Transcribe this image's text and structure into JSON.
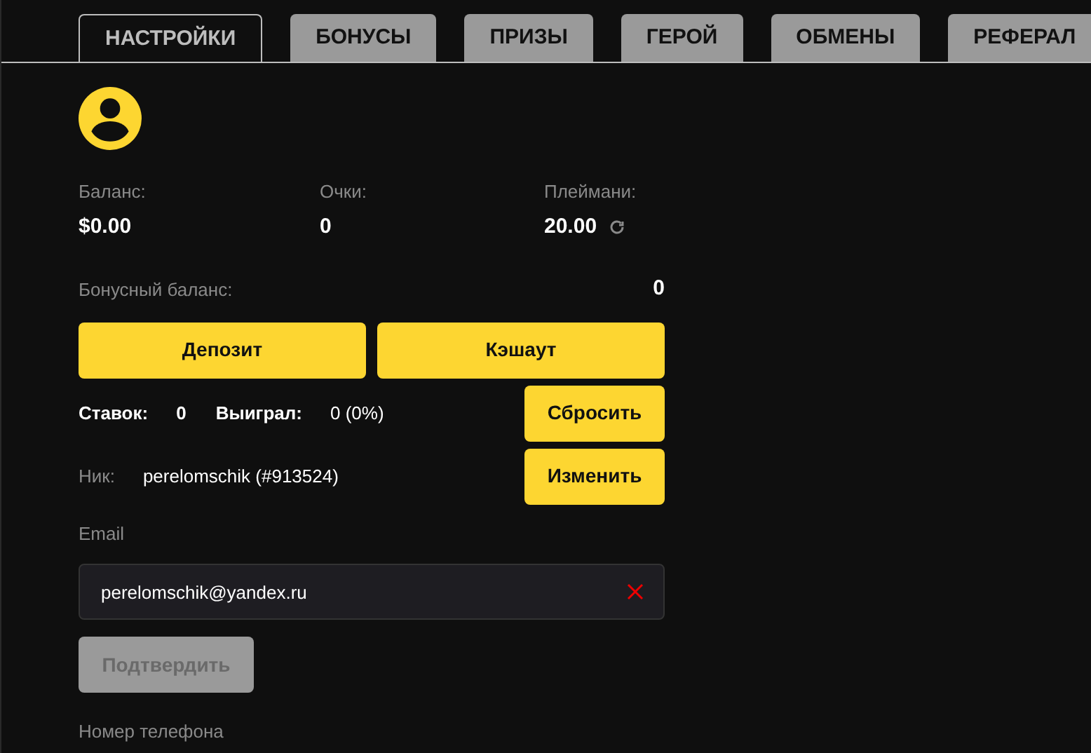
{
  "tabs": [
    {
      "label": "НАСТРОЙКИ",
      "selected": true
    },
    {
      "label": "БОНУСЫ",
      "selected": false
    },
    {
      "label": "ПРИЗЫ",
      "selected": false
    },
    {
      "label": "ГЕРОЙ",
      "selected": false
    },
    {
      "label": "ОБМЕНЫ",
      "selected": false
    },
    {
      "label": "РЕФЕРАЛ",
      "selected": false
    }
  ],
  "stats": [
    {
      "label": "Баланс:",
      "value": "$0.00",
      "refresh": false
    },
    {
      "label": "Очки:",
      "value": "0",
      "refresh": false
    },
    {
      "label": "Плеймани:",
      "value": "20.00",
      "refresh": true
    }
  ],
  "bonus_balance": {
    "label": "Бонусный баланс:",
    "value": "0"
  },
  "actions": [
    "Депозит",
    "Кэшаут"
  ],
  "bets": {
    "label": "Ставок:",
    "value": "0",
    "won_label": "Выиграл:",
    "won_value": "0 (0%)",
    "button": "Сбросить"
  },
  "nick": {
    "label": "Ник:",
    "value": "perelomschik (#913524)",
    "button": "Изменить"
  },
  "email": {
    "label": "Email",
    "value": "perelomschik@yandex.ru",
    "confirm": {
      "label": "Подтвердить",
      "disabled": true
    }
  },
  "phone": {
    "label": "Номер телефона"
  }
}
